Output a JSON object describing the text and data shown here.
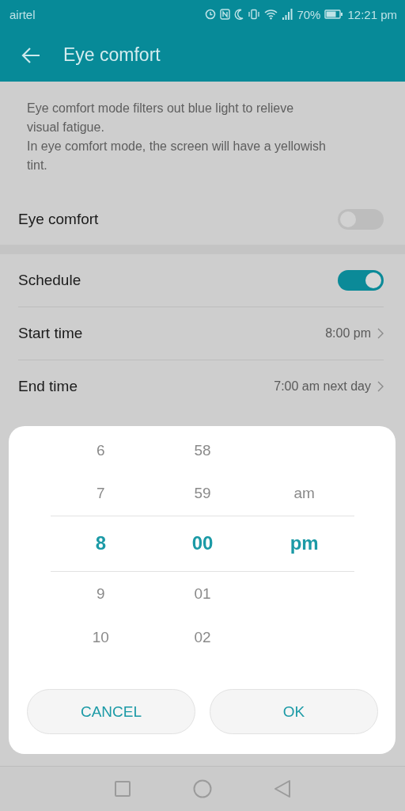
{
  "status_bar": {
    "carrier": "airtel",
    "battery": "70%",
    "time": "12:21 pm"
  },
  "app_bar": {
    "title": "Eye comfort"
  },
  "description": "Eye comfort mode filters out blue light to relieve visual fatigue.\nIn eye comfort mode, the screen will have a yellowish tint.",
  "eye_comfort": {
    "label": "Eye comfort",
    "on": false
  },
  "schedule_rows": [
    {
      "kind": "toggle",
      "label": "Schedule",
      "on": true
    },
    {
      "kind": "link",
      "label": "Start time",
      "value": "8:00 pm"
    },
    {
      "kind": "link",
      "label": "End time",
      "value": "7:00 am next day"
    }
  ],
  "time_picker": {
    "columns": [
      [
        {
          "label": "6",
          "selected": false
        },
        {
          "label": "7",
          "selected": false
        },
        {
          "label": "8",
          "selected": true
        },
        {
          "label": "9",
          "selected": false
        },
        {
          "label": "10",
          "selected": false
        }
      ],
      [
        {
          "label": "58",
          "selected": false
        },
        {
          "label": "59",
          "selected": false
        },
        {
          "label": "00",
          "selected": true
        },
        {
          "label": "01",
          "selected": false
        },
        {
          "label": "02",
          "selected": false
        }
      ],
      [
        {
          "label": "am",
          "selected": false
        },
        {
          "label": "pm",
          "selected": true
        }
      ]
    ],
    "buttons": [
      "CANCEL",
      "OK"
    ]
  }
}
